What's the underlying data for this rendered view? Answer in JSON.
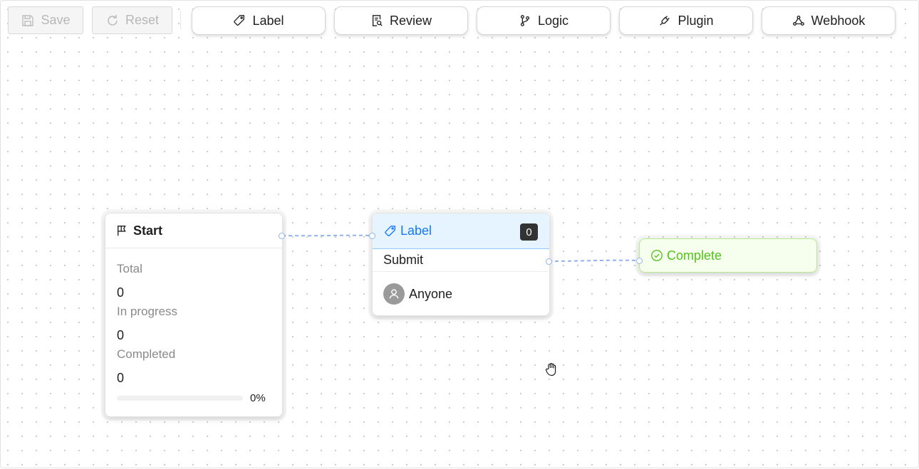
{
  "toolbar": {
    "save_label": "Save",
    "reset_label": "Reset",
    "node_buttons": [
      {
        "label": "Label",
        "icon": "tag-icon"
      },
      {
        "label": "Review",
        "icon": "review-doc-icon"
      },
      {
        "label": "Logic",
        "icon": "branch-icon"
      },
      {
        "label": "Plugin",
        "icon": "plugin-icon"
      },
      {
        "label": "Webhook",
        "icon": "webhook-icon"
      }
    ]
  },
  "start_node": {
    "title": "Start",
    "icon": "flag-icon",
    "stats": [
      {
        "label": "Total",
        "value": "0"
      },
      {
        "label": "In progress",
        "value": "0"
      },
      {
        "label": "Completed",
        "value": "0"
      }
    ],
    "progress": 0,
    "progress_text": "0%"
  },
  "label_node": {
    "title": "Label",
    "icon": "tag-icon",
    "count": "0",
    "action": "Submit",
    "assignee": "Anyone",
    "assignee_icon": "user-icon"
  },
  "complete_node": {
    "title": "Complete",
    "icon": "check-circle-icon"
  },
  "colors": {
    "primary": "#1677ff",
    "success": "#52c41a",
    "edge": "#8fb3ea"
  }
}
